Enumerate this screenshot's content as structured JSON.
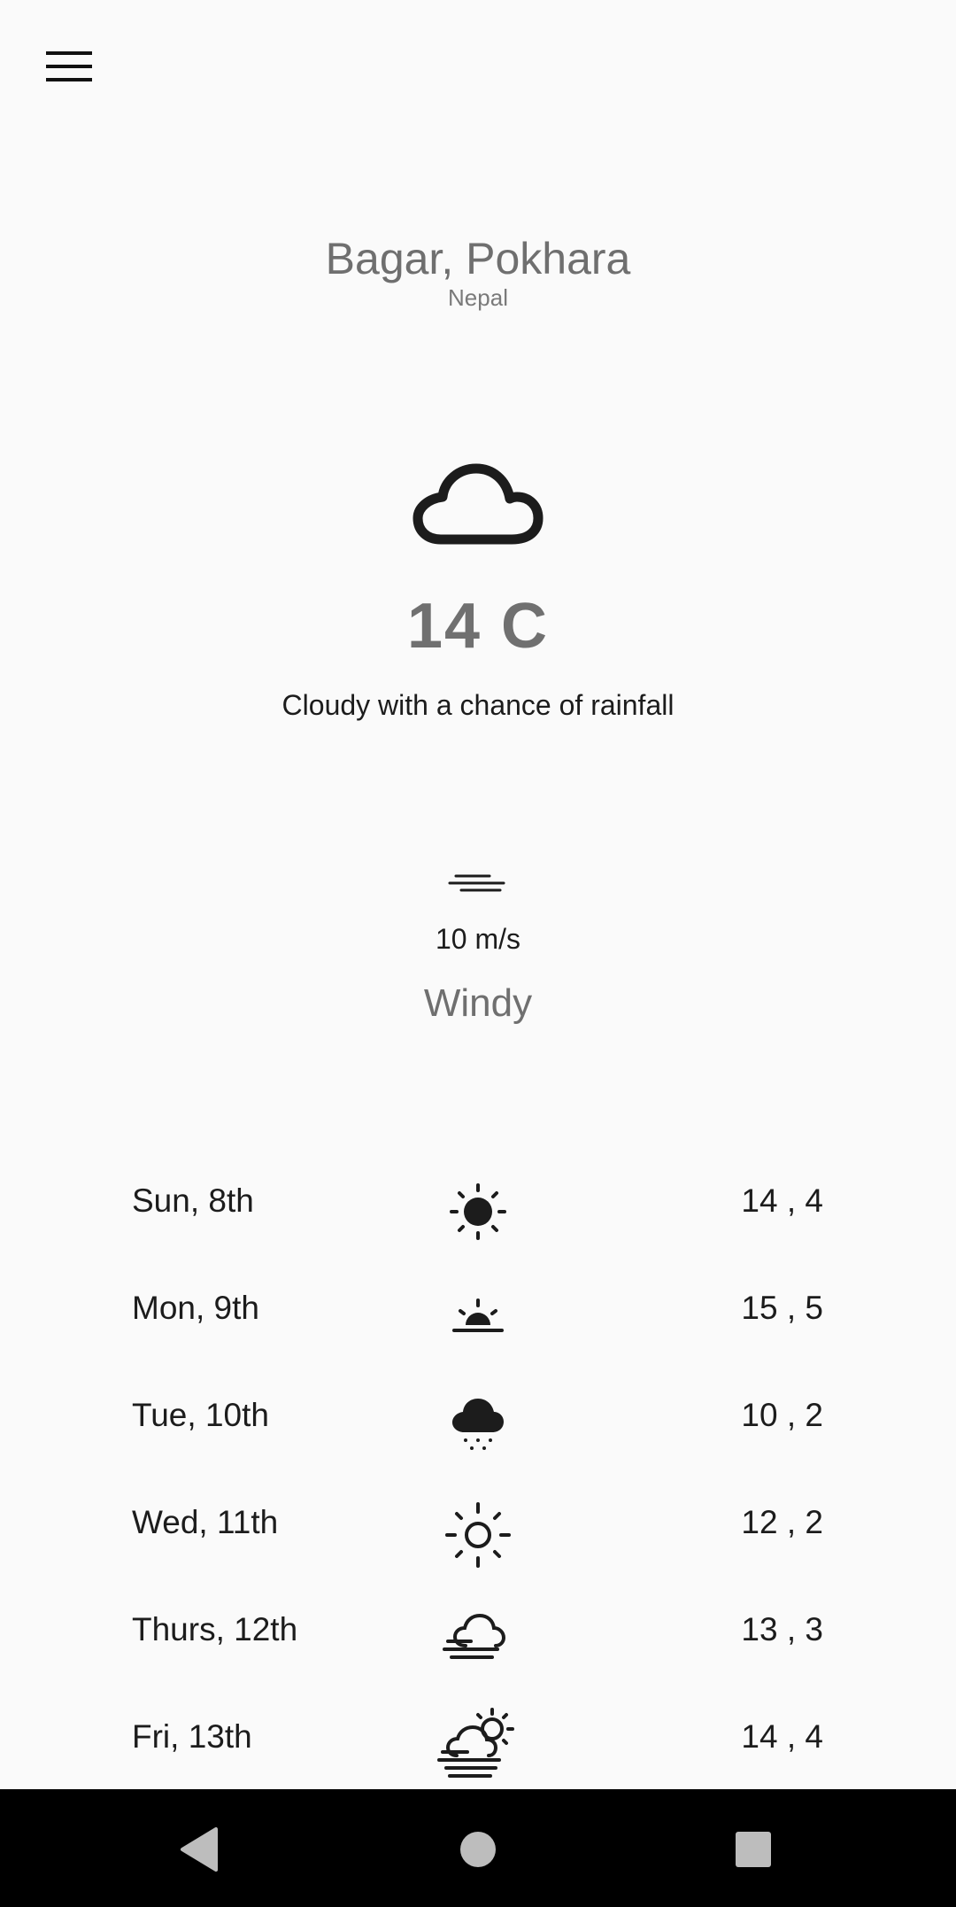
{
  "header": {
    "menu_icon": "hamburger-menu-icon"
  },
  "location": {
    "city": "Bagar, Pokhara",
    "country": "Nepal"
  },
  "current": {
    "icon": "cloud-icon",
    "temperature": "14 C",
    "description": "Cloudy with a chance of rainfall"
  },
  "wind": {
    "icon": "wind-icon",
    "speed": "10 m/s",
    "label": "Windy"
  },
  "forecast": [
    {
      "day": "Sun, 8th",
      "icon": "sun-filled-icon",
      "temps": "14 , 4"
    },
    {
      "day": "Mon, 9th",
      "icon": "sunrise-icon",
      "temps": "15 , 5"
    },
    {
      "day": "Tue, 10th",
      "icon": "cloud-snow-icon",
      "temps": "10 , 2"
    },
    {
      "day": "Wed, 11th",
      "icon": "sun-outline-icon",
      "temps": "12 , 2"
    },
    {
      "day": "Thurs, 12th",
      "icon": "cloud-fog-icon",
      "temps": "13 , 3"
    },
    {
      "day": "Fri, 13th",
      "icon": "partly-cloudy-fog-icon",
      "temps": "14 , 4"
    }
  ],
  "navbar": {
    "back_icon": "back-triangle-icon",
    "home_icon": "home-circle-icon",
    "recents_icon": "recents-square-icon"
  },
  "colors": {
    "background": "#fafafa",
    "primary_text": "#1c1c1c",
    "secondary_text": "#6f6f6f",
    "icon": "#1c1c1c",
    "navbar": "#000000"
  }
}
